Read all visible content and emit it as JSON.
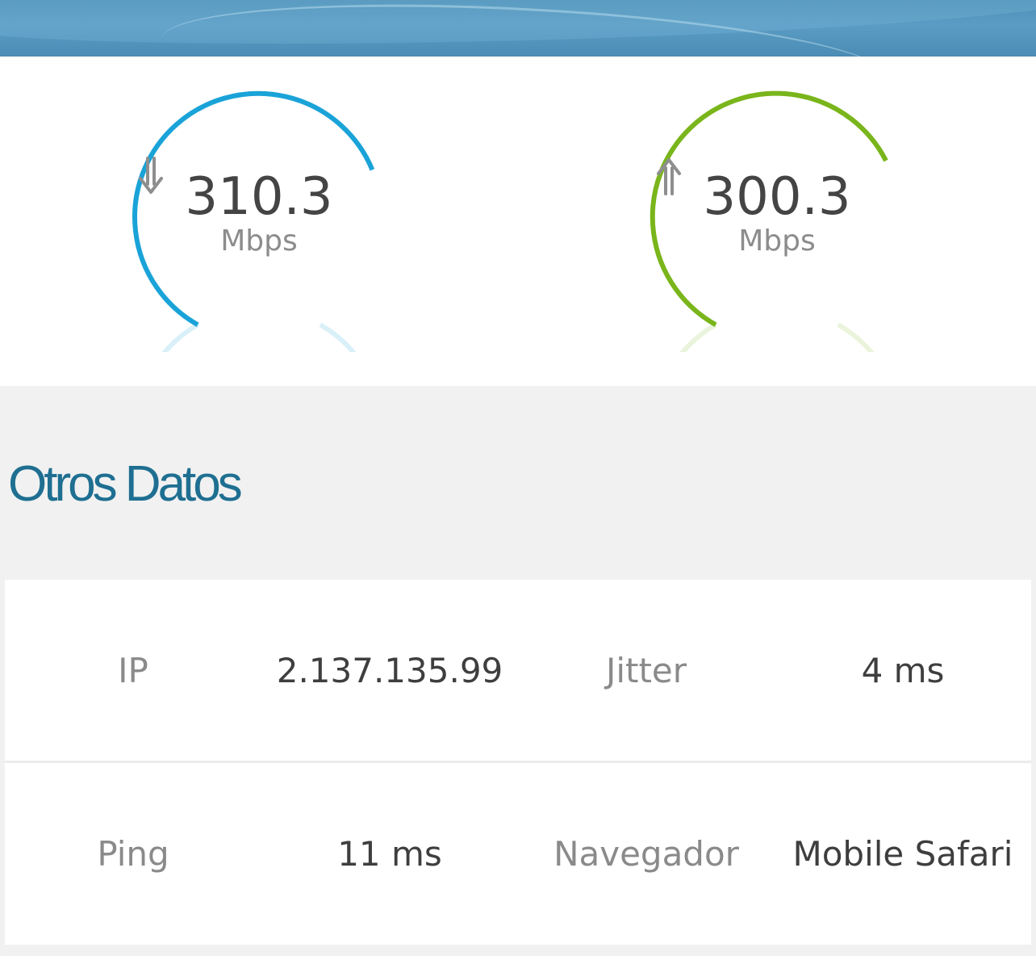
{
  "download": {
    "value": "310.3",
    "unit": "Mbps",
    "icon": "arrow-down-icon",
    "color": "#1aa3d8",
    "track_color": "#d9f0f9"
  },
  "upload": {
    "value": "300.3",
    "unit": "Mbps",
    "icon": "arrow-up-icon",
    "color": "#79b51b",
    "track_color": "#eaf4dc"
  },
  "section": {
    "title": "Otros Datos",
    "title_color": "#1e6f91"
  },
  "details": {
    "rows": [
      {
        "label1": "IP",
        "value1": "2.137.135.99",
        "label2": "Jitter",
        "value2": "4 ms"
      },
      {
        "label1": "Ping",
        "value1": "11 ms",
        "label2": "Navegador",
        "value2": "Mobile Safari"
      }
    ]
  }
}
